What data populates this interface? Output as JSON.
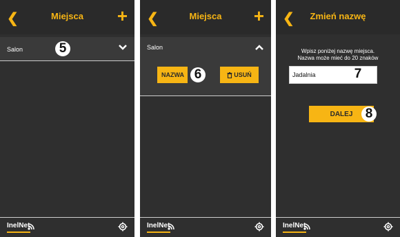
{
  "screen1": {
    "title": "Miejsca",
    "row_label": "Salon",
    "marker": "5"
  },
  "screen2": {
    "title": "Miejsca",
    "row_label": "Salon",
    "btn_nazwa": "NAZWA",
    "btn_usun": "USUŃ",
    "marker": "6"
  },
  "screen3": {
    "title": "Zmień nazwę",
    "message_line1": "Wpisz poniżej nazwę miejsca.",
    "message_line2": "Nazwa może mieć do 20 znaków",
    "input_value": "Jadalnia",
    "input_marker": "7",
    "btn_dalej": "DALEJ",
    "btn_marker": "8"
  },
  "footer": {
    "logo": "InelNet"
  },
  "icons": {
    "back": "chevron-left-icon",
    "add": "plus-icon",
    "expand": "chevron-down-icon",
    "collapse": "chevron-up-icon",
    "delete": "trash-icon",
    "settings": "gear-icon",
    "signal": "wifi-icon"
  },
  "colors": {
    "accent": "#f7b514",
    "background": "#2f2f2f"
  }
}
